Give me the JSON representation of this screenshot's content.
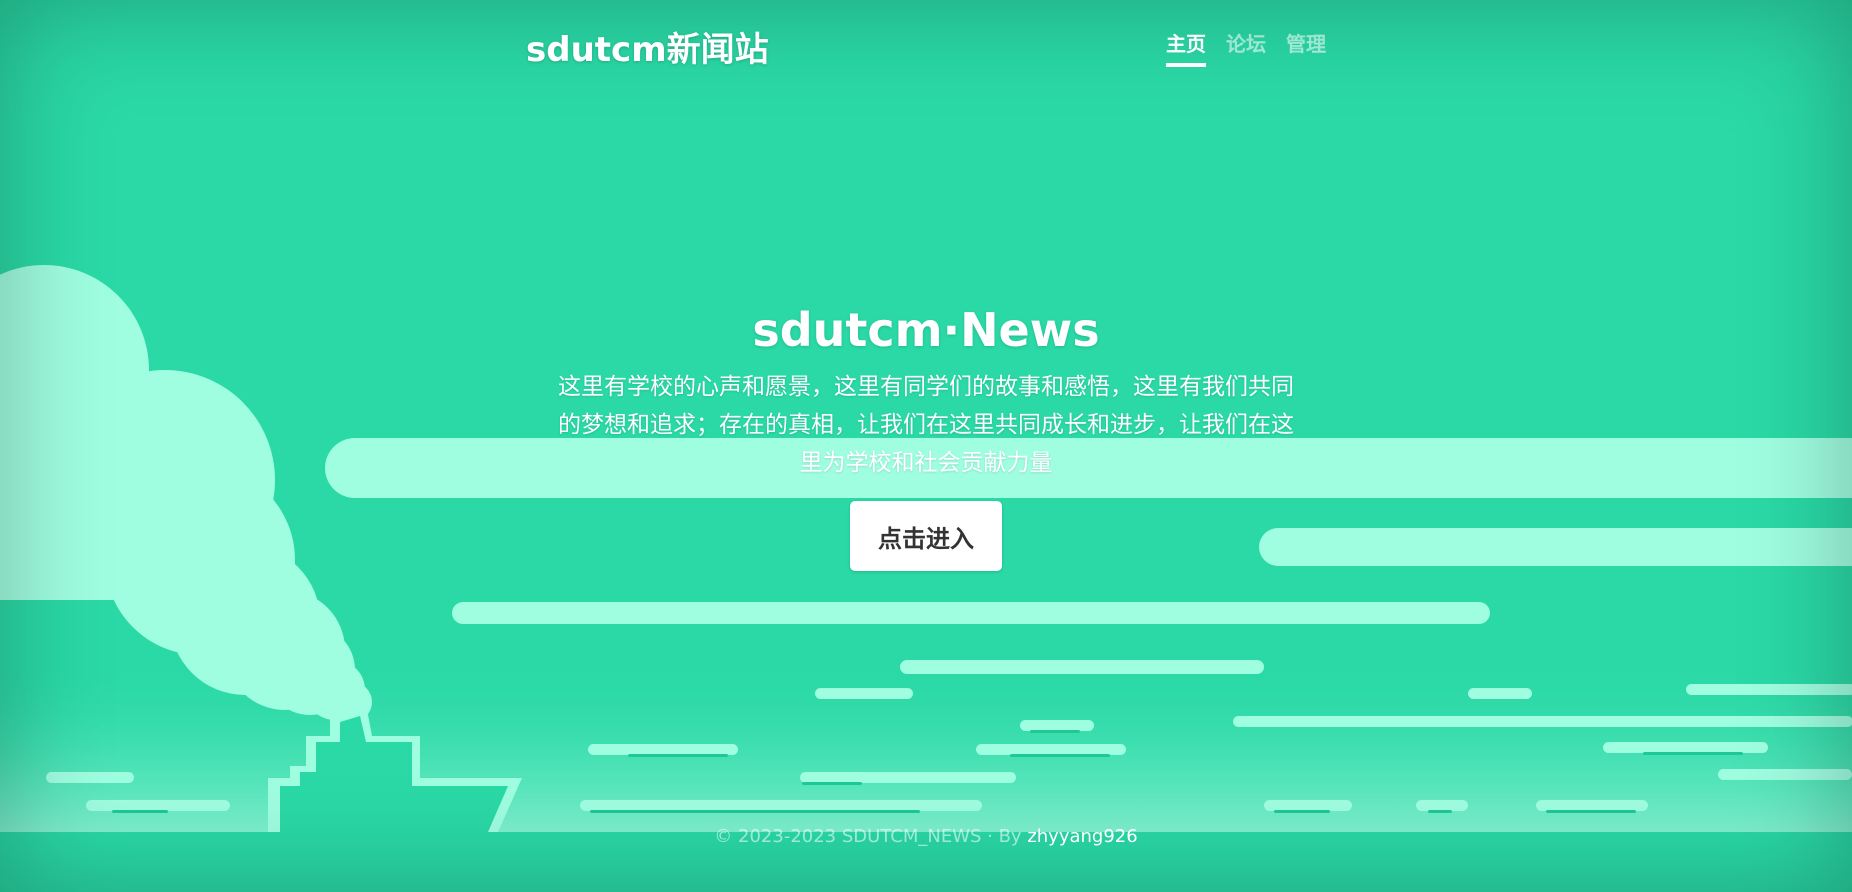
{
  "header": {
    "brand": "sdutcm新闻站",
    "nav": [
      {
        "label": "主页",
        "active": true
      },
      {
        "label": "论坛",
        "active": false
      },
      {
        "label": "管理",
        "active": false
      }
    ]
  },
  "hero": {
    "title": "sdutcm·News",
    "lead": "这里有学校的心声和愿景，这里有同学们的故事和感悟，这里有我们共同的梦想和追求；存在的真相，让我们在这里共同成长和进步，让我们在这里为学校和社会贡献力量",
    "button_label": "点击进入"
  },
  "footer": {
    "copyright": "© 2023-2023 SDUTCM_NEWS · By ",
    "author": "zhyyang926"
  },
  "colors": {
    "background": "#2ad9a6",
    "cloud": "#9ffde0",
    "text": "#ffffff",
    "button_text": "#333333"
  }
}
